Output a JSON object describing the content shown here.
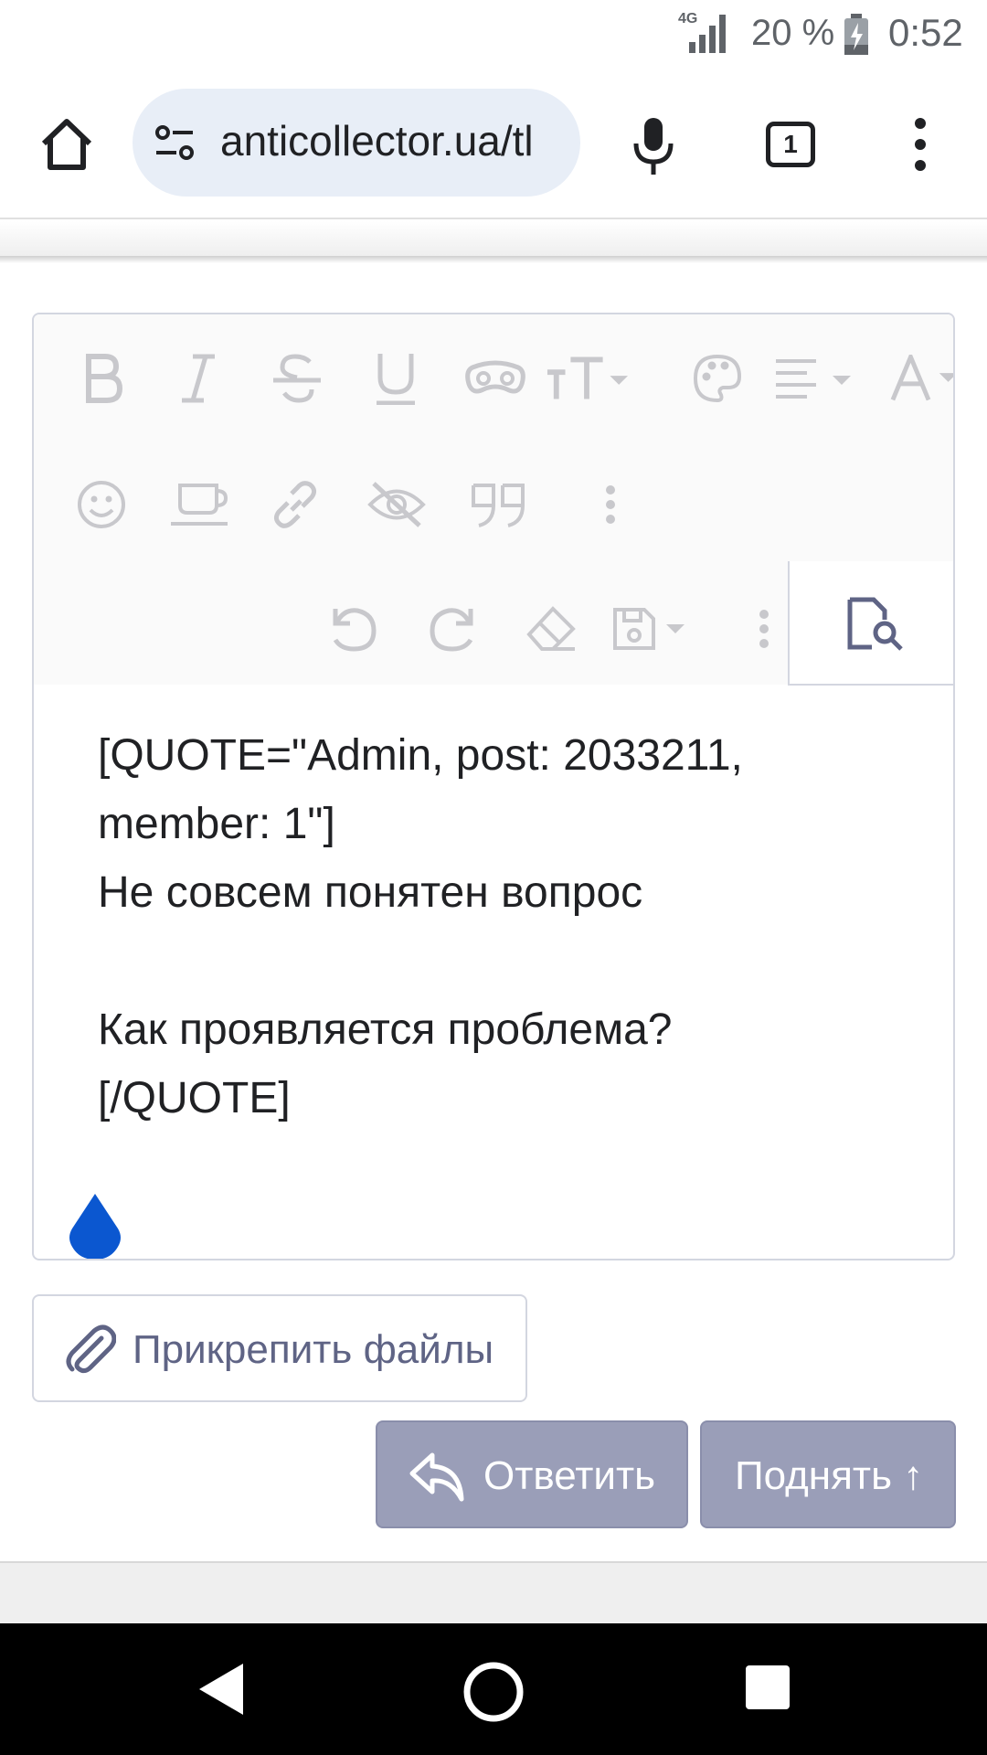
{
  "status_bar": {
    "network": "4G",
    "battery_percent": "20 %",
    "time": "0:52"
  },
  "browser": {
    "url": "anticollector.ua/tl",
    "tab_count": "1"
  },
  "editor": {
    "toolbar_row1": [
      "bold-icon",
      "italic-icon",
      "strikethrough-icon",
      "underline-icon",
      "spoiler-icon",
      "font-size-icon",
      "palette-icon",
      "align-icon",
      "font-icon"
    ],
    "toolbar_row2": [
      "smiley-icon",
      "media-icon",
      "link-icon",
      "hide-icon",
      "quote-icon",
      "more-icon"
    ],
    "toolbar_row3": [
      "undo-icon",
      "redo-icon",
      "eraser-icon",
      "save-icon",
      "more-icon",
      "preview-icon"
    ],
    "content_lines": [
      "[QUOTE=\"Admin, post: 2033211,",
      "member: 1\"]",
      "Не совсем понятен вопрос",
      "",
      "Как проявляется проблема?",
      "[/QUOTE]"
    ]
  },
  "actions": {
    "attach_label": "Прикрепить файлы",
    "reply_label": "Ответить",
    "bump_label": "Поднять ↑"
  },
  "colors": {
    "button_bg": "#9a9eb8",
    "accent_blue": "#0b57d0",
    "toolbar_icon": "#c8c8cc"
  }
}
